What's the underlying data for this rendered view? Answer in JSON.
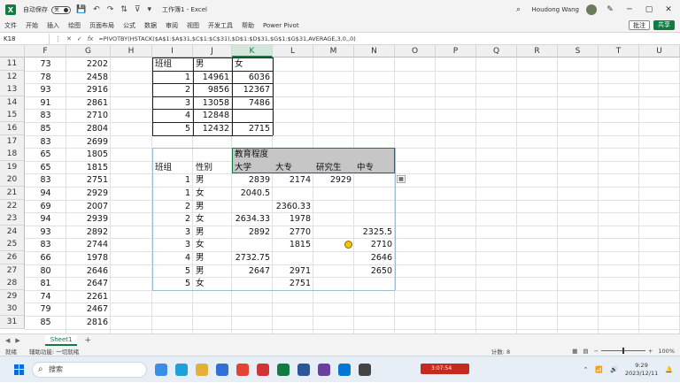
{
  "titlebar": {
    "autosave_label": "自动保存",
    "autosave_state": "关",
    "doc_title": "工作簿1 - Excel",
    "user_name": "Houdong Wang"
  },
  "ribbon": {
    "tabs": [
      "文件",
      "开始",
      "插入",
      "绘图",
      "页面布局",
      "公式",
      "数据",
      "审阅",
      "视图",
      "开发工具",
      "帮助",
      "Power Pivot"
    ],
    "comment_label": "批注",
    "share_label": "共享"
  },
  "formula_bar": {
    "name_box": "K18",
    "formula": "=PIVOTBY(HSTACK($A$1:$A$31,$C$1:$C$31),$D$1:$D$31,$G$1:$G$31,AVERAGE,3,0,,0)"
  },
  "columns": [
    "F",
    "G",
    "H",
    "I",
    "J",
    "K",
    "L",
    "M",
    "N",
    "O",
    "P",
    "Q",
    "R",
    "S",
    "T",
    "U"
  ],
  "rows": [
    "11",
    "12",
    "13",
    "14",
    "15",
    "16",
    "17",
    "18",
    "19",
    "20",
    "21",
    "22",
    "23",
    "24",
    "25",
    "26",
    "27",
    "28",
    "29",
    "30",
    "31"
  ],
  "col_f": [
    "73",
    "78",
    "93",
    "91",
    "83",
    "85",
    "83",
    "65",
    "65",
    "83",
    "94",
    "69",
    "94",
    "93",
    "83",
    "66",
    "80",
    "81",
    "74",
    "79",
    "85"
  ],
  "col_g": [
    "2202",
    "2458",
    "2916",
    "2861",
    "2710",
    "2804",
    "2699",
    "1805",
    "1815",
    "2751",
    "2929",
    "2007",
    "2939",
    "2892",
    "2744",
    "1978",
    "2646",
    "2647",
    "2261",
    "2467",
    "2816"
  ],
  "pivot1": {
    "header": [
      "班组",
      "男",
      "女"
    ],
    "rows": [
      [
        "1",
        "14961",
        "6036"
      ],
      [
        "2",
        "9856",
        "12367"
      ],
      [
        "3",
        "13058",
        "7486"
      ],
      [
        "4",
        "12848",
        ""
      ],
      [
        "5",
        "12432",
        "2715"
      ]
    ]
  },
  "pivot2": {
    "edu_label": "教育程度",
    "row_label1": "班组",
    "row_label2": "性别",
    "edu_cols": [
      "大学",
      "大专",
      "研究生",
      "中专"
    ],
    "rows": [
      [
        "1",
        "男",
        "2839",
        "2174",
        "2929",
        ""
      ],
      [
        "1",
        "女",
        "2040.5",
        "",
        "",
        ""
      ],
      [
        "2",
        "男",
        "",
        "2360.33",
        "",
        ""
      ],
      [
        "2",
        "女",
        "2634.33",
        "1978",
        "",
        ""
      ],
      [
        "3",
        "男",
        "2892",
        "2770",
        "",
        "2325.5"
      ],
      [
        "3",
        "女",
        "",
        "1815",
        "",
        "2710"
      ],
      [
        "4",
        "男",
        "2732.75",
        "",
        "",
        "2646"
      ],
      [
        "5",
        "男",
        "2647",
        "2971",
        "",
        "2650"
      ],
      [
        "5",
        "女",
        "",
        "2751",
        "",
        ""
      ]
    ]
  },
  "sheet": {
    "tab": "Sheet1",
    "add": "+"
  },
  "status": {
    "ready": "就绪",
    "accessibility": "辅助功能: 一切就绪",
    "count": "计数: 8",
    "zoom": "100%"
  },
  "taskbar": {
    "search_placeholder": "搜索",
    "time": "9:29",
    "date": "2023/12/11",
    "recording": "3:07:54"
  },
  "colors": {
    "accent": "#107c41",
    "header_fill": "#c6c6c6",
    "spill_border": "#9bbfd0"
  }
}
